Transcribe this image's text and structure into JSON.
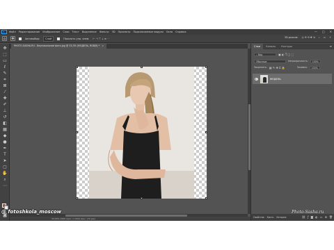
{
  "app": {
    "logo": "Ps",
    "menu": [
      "Файл",
      "Редактирование",
      "Изображение",
      "Слои",
      "Текст",
      "Выделение",
      "Фильтр",
      "3D",
      "Просмотр",
      "Подключаемые модули",
      "Окно",
      "Справка"
    ],
    "window_controls": [
      "—",
      "□",
      "✕"
    ]
  },
  "options_bar": {
    "autoselect_label": "Автовыбор:",
    "autoselect_value": "Слой",
    "transform_label": "Показать упр. элем.",
    "mode_3d_label": "3D-режим:"
  },
  "document_tab": {
    "title": "PHOTO-SASHA.RU - Вертикальное фото.jpg @ 33,3% (МОДЕЛЬ, RGB/8) *",
    "close": "×"
  },
  "status": {
    "text": "33,33%   1500 пикс. x 1500 пикс. (72 ppi)"
  },
  "layers_panel": {
    "tabs": [
      "Слои",
      "Каналы",
      "Контуры"
    ],
    "active_tab": "Слои",
    "filter_label": "Вид",
    "blend_mode": "Обычные",
    "opacity_label": "Непрозрачность:",
    "opacity_value": "100%",
    "lock_label": "Закрепить:",
    "fill_label": "Заливка:",
    "fill_value": "100%",
    "layer_name": "МОДЕЛЬ",
    "bottom_tabs": [
      "Свойства",
      "Кисть",
      "История"
    ]
  },
  "watermarks": {
    "left": "@ fotoshkola_moscow",
    "right": "Photo-Sasha.ru"
  },
  "icons": {
    "menu_panel": "panel-menu-icon",
    "eye": "eye-icon"
  },
  "colors": {
    "foreground_swatch": "#8a5a3c",
    "background_swatch": "#f0f0f0",
    "ps_blue": "#31a8ff"
  }
}
